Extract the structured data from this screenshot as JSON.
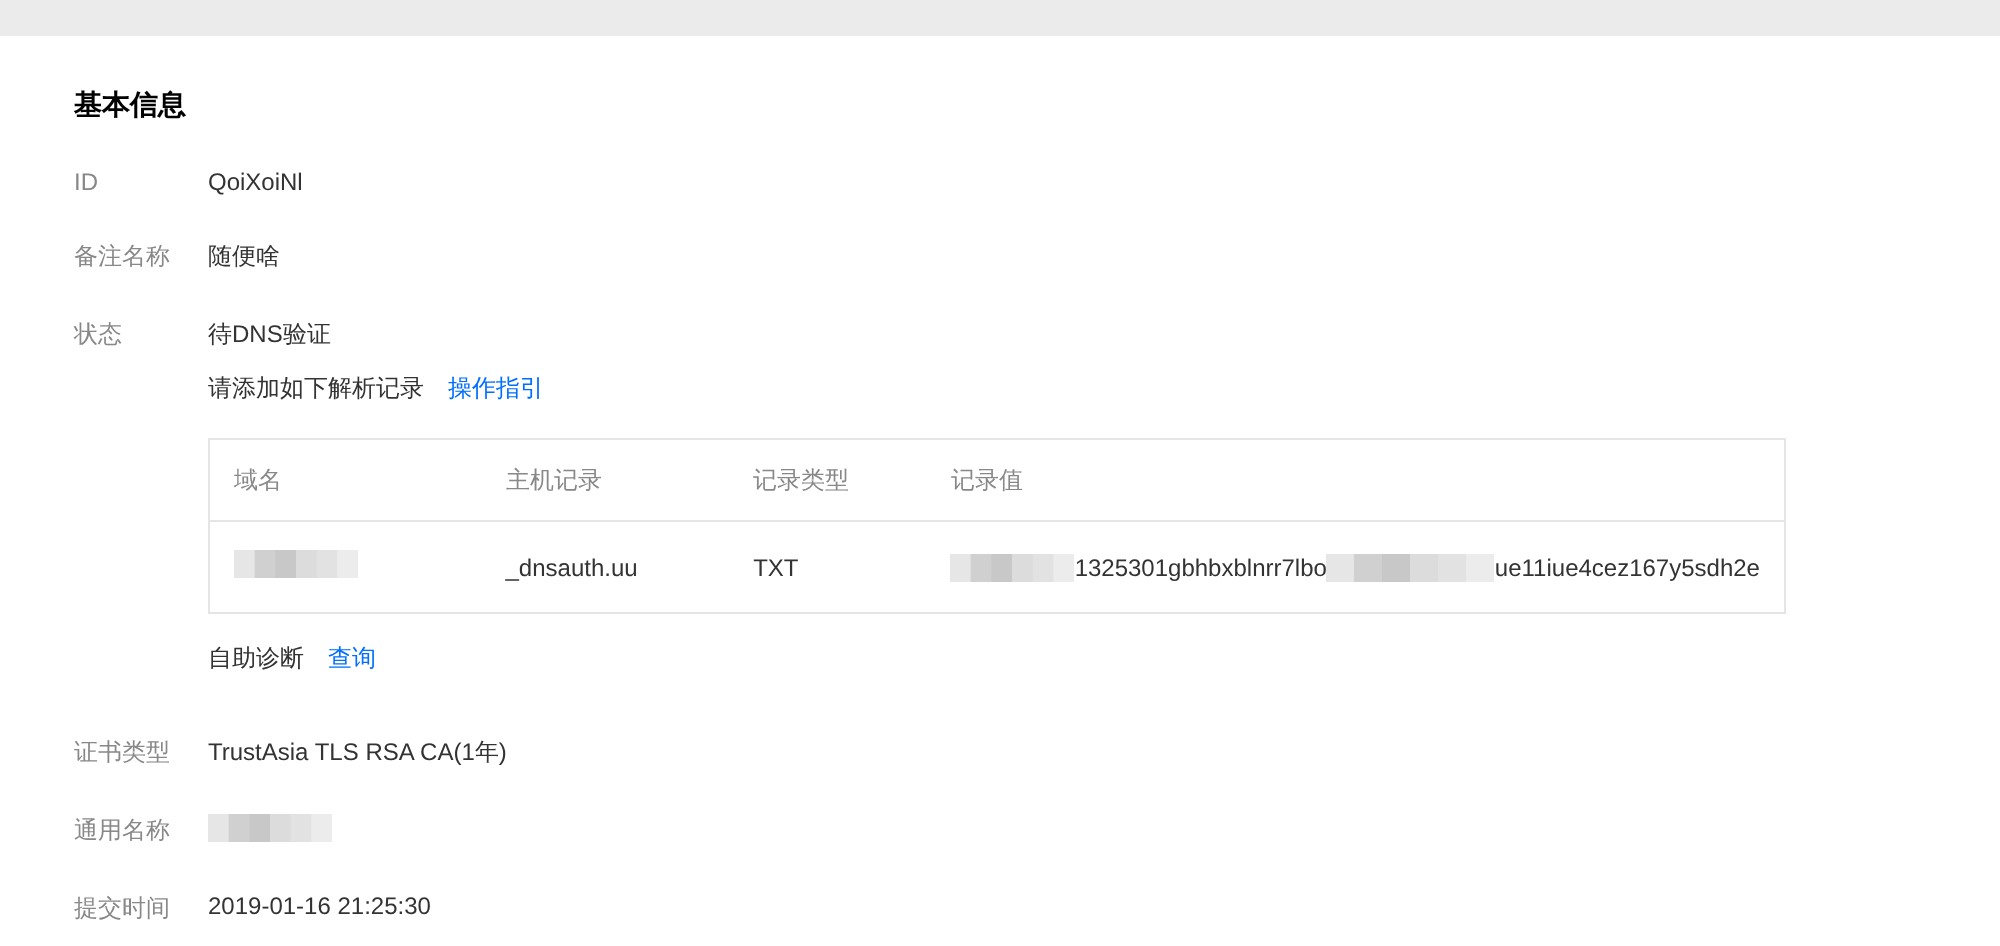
{
  "title": "基本信息",
  "fields": [
    {
      "label": "ID",
      "value": "QoiXoiNl"
    },
    {
      "label": "备注名称",
      "value": "随便啥"
    }
  ],
  "status": {
    "label": "状态",
    "value": "待DNS验证",
    "hint": "请添加如下解析记录",
    "hint_link": "操作指引",
    "table": {
      "columns": [
        "域名",
        "主机记录",
        "记录类型",
        "记录值"
      ],
      "rows": [
        {
          "domain_redacted": true,
          "host": "_dnsauth.uu",
          "type": "TXT",
          "value_parts": [
            "1325301gbhbxblnrr7lbo",
            "ue11iue4cez167y5sdh2e"
          ]
        }
      ]
    },
    "diagnose": "自助诊断",
    "diagnose_link": "查询"
  },
  "details": [
    {
      "label": "证书类型",
      "value": "TrustAsia TLS RSA CA(1年)",
      "redacted": false
    },
    {
      "label": "通用名称",
      "redacted": true
    },
    {
      "label": "提交时间",
      "value": "2019-01-16 21:25:30",
      "redacted": false
    }
  ]
}
